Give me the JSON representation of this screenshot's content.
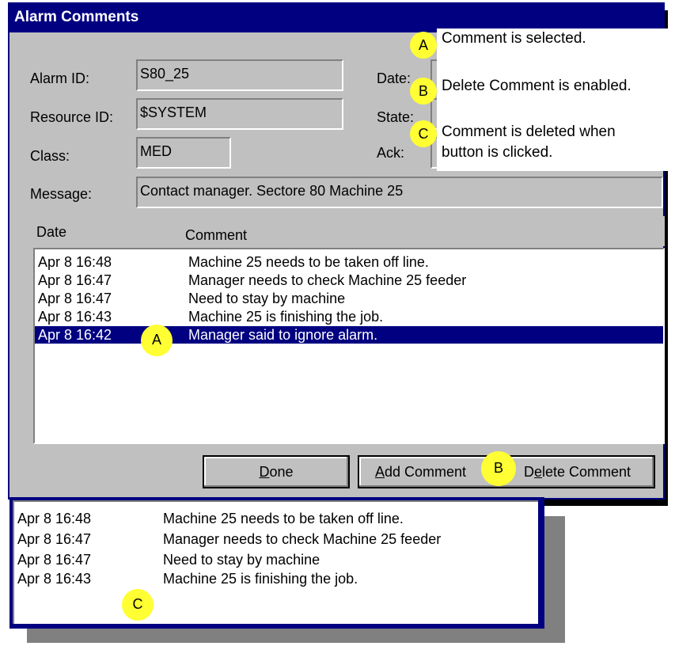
{
  "dialog": {
    "title": "Alarm Comments",
    "fields": {
      "alarm_id_label": "Alarm ID:",
      "alarm_id_value": "S80_25",
      "resource_id_label": "Resource ID:",
      "resource_id_value": "$SYSTEM",
      "class_label": "Class:",
      "class_value": "MED",
      "date_label": "Date:",
      "state_label": "State:",
      "ack_label": "Ack:",
      "message_label": "Message:",
      "message_value": "Contact manager. Sectore 80 Machine 25"
    },
    "list": {
      "col_date": "Date",
      "col_comment": "Comment",
      "rows": [
        {
          "date": "Apr 8 16:48",
          "comment": "Machine 25 needs to be taken off line."
        },
        {
          "date": "Apr 8 16:47",
          "comment": "Manager needs to check Machine 25 feeder"
        },
        {
          "date": "Apr 8 16:47",
          "comment": "Need to stay by machine"
        },
        {
          "date": "Apr 8 16:43",
          "comment": "Machine 25 is finishing the job."
        },
        {
          "date": "Apr 8 16:42",
          "comment": "Manager said to ignore alarm.",
          "selected": true
        }
      ]
    },
    "buttons": {
      "done_u": "D",
      "done_rest": "one",
      "add_u": "A",
      "add_rest": "dd Comment",
      "delete_pre": "D",
      "delete_u": "e",
      "delete_rest": "lete Comment"
    }
  },
  "annotations": {
    "a": {
      "letter": "A",
      "text": "Comment is selected."
    },
    "b": {
      "letter": "B",
      "text": "Delete Comment is enabled."
    },
    "c": {
      "letter": "C",
      "text_line1": "Comment  is deleted when",
      "text_line2": "button is clicked."
    }
  },
  "result_list": {
    "rows": [
      {
        "date": "Apr 8 16:48",
        "comment": "Machine 25 needs to be taken off line."
      },
      {
        "date": "Apr 8 16:47",
        "comment": "Manager needs to check Machine 25 feeder"
      },
      {
        "date": "Apr 8 16:47",
        "comment": "Need to stay by machine"
      },
      {
        "date": "Apr 8 16:43",
        "comment": "Machine 25 is finishing the job."
      }
    ]
  },
  "colors": {
    "title_bar": "#000080",
    "dialog_bg": "#c0c0c0",
    "selection": "#000080",
    "callout": "#ffff33"
  }
}
